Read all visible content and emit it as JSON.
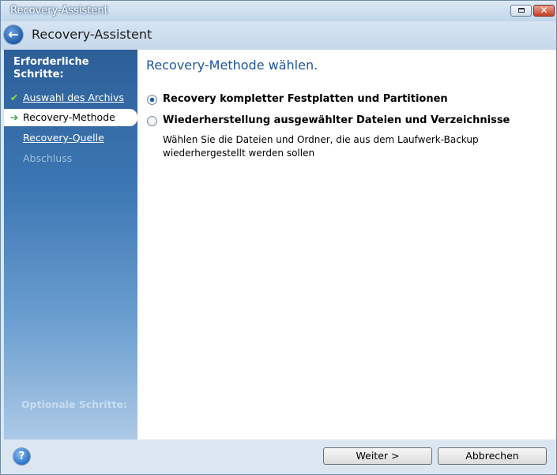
{
  "window": {
    "title": "Recovery-Assistent",
    "restore_icon": "restore-icon",
    "close_icon": "close-icon",
    "close_glyph": "✕"
  },
  "header": {
    "back_icon": "back-arrow-icon",
    "back_glyph": "←",
    "title": "Recovery-Assistent"
  },
  "sidebar": {
    "heading": "Erforderliche Schritte:",
    "steps": [
      {
        "label": "Auswahl des Archivs",
        "state": "done",
        "icon": "checkmark-icon",
        "glyph": "✔"
      },
      {
        "label": "Recovery-Methode",
        "state": "current",
        "icon": "arrow-right-icon",
        "glyph": "➔"
      },
      {
        "label": "Recovery-Quelle",
        "state": "link"
      },
      {
        "label": "Abschluss",
        "state": "disabled"
      }
    ],
    "optional_heading": "Optionale Schritte:"
  },
  "main": {
    "title": "Recovery-Methode wählen.",
    "options": [
      {
        "label": "Recovery kompletter Festplatten und Partitionen",
        "checked": true
      },
      {
        "label": "Wiederherstellung ausgewählter Dateien und Verzeichnisse",
        "checked": false
      }
    ],
    "description": "Wählen Sie die Dateien und Ordner, die aus dem Laufwerk-Backup wiederhergestellt werden sollen"
  },
  "footer": {
    "help_icon": "help-icon",
    "help_glyph": "?",
    "next_label": "Weiter >",
    "cancel_label": "Abbrechen"
  }
}
